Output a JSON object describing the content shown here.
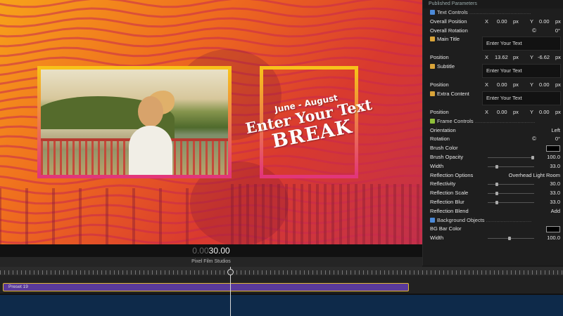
{
  "viewer": {
    "subtitle": "June - August",
    "main_title": "Enter Your Text",
    "extra_content": "BREAK"
  },
  "inspector": {
    "header": "Published Parameters",
    "text_controls": "Text Controls",
    "overall_position": {
      "label": "Overall Position",
      "x_label": "X",
      "x": "0.00",
      "x_unit": "px",
      "y_label": "Y",
      "y": "0.00",
      "y_unit": "px"
    },
    "overall_rotation": {
      "label": "Overall Rotation",
      "value": "0°"
    },
    "main_title": {
      "label": "Main Title",
      "text": "Enter Your Text"
    },
    "main_position": {
      "label": "Position",
      "x_label": "X",
      "x": "13.62",
      "x_unit": "px",
      "y_label": "Y",
      "y": "-6.62",
      "y_unit": "px"
    },
    "subtitle": {
      "label": "Subtitle",
      "text": "Enter Your Text"
    },
    "subtitle_position": {
      "label": "Position",
      "x_label": "X",
      "x": "0.00",
      "x_unit": "px",
      "y_label": "Y",
      "y": "0.00",
      "y_unit": "px"
    },
    "extra_content": {
      "label": "Extra Content",
      "text": "Enter Your Text"
    },
    "extra_position": {
      "label": "Position",
      "x_label": "X",
      "x": "0.00",
      "x_unit": "px",
      "y_label": "Y",
      "y": "0.00",
      "y_unit": "px"
    },
    "frame_controls": "Frame Controls",
    "orientation": {
      "label": "Orientation",
      "value": "Left"
    },
    "rotation": {
      "label": "Rotation",
      "value": "0°"
    },
    "brush_color": {
      "label": "Brush Color",
      "color": "#000000"
    },
    "brush_opacity": {
      "label": "Brush Opacity",
      "value": "100.0",
      "level": 1.0
    },
    "width": {
      "label": "Width",
      "value": "33.0",
      "level": 0.17
    },
    "reflection_options": {
      "label": "Reflection Options",
      "value": "Overhead Light Room"
    },
    "reflectivity": {
      "label": "Reflectivity",
      "value": "30.0",
      "level": 0.17
    },
    "reflection_scale": {
      "label": "Reflection Scale",
      "value": "33.0",
      "level": 0.17
    },
    "reflection_blur": {
      "label": "Reflection Blur",
      "value": "33.0",
      "level": 0.17
    },
    "reflection_blend": {
      "label": "Reflection Blend",
      "value": "Add"
    },
    "background_objects": "Background Objects",
    "bg_bar_color": {
      "label": "BG Bar Color",
      "color": "#000000"
    },
    "bg_width": {
      "label": "Width",
      "value": "100.0",
      "level": 0.47
    }
  },
  "timeline": {
    "timecode_dim": "0.00",
    "timecode_main": "30.00",
    "project_name": "Pixel Film Studios",
    "clip_label": "Preset 19"
  },
  "colors": {
    "accent_gold": "#f7c21a",
    "accent_pink": "#e2367a",
    "clip_purple": "#5a3a9a",
    "clip_border": "#e0b830"
  }
}
